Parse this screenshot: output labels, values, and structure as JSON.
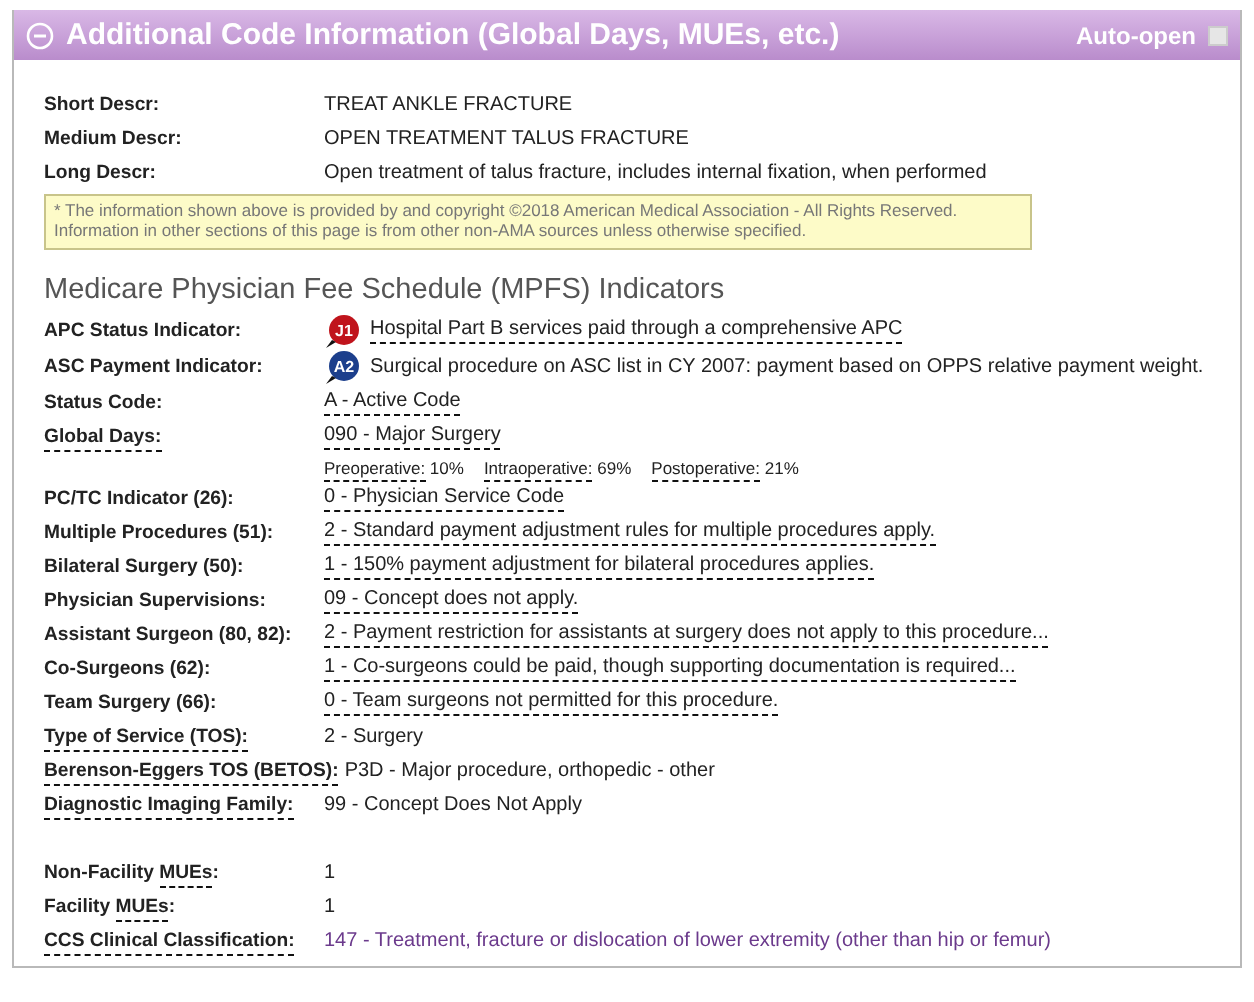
{
  "panel": {
    "title": "Additional Code Information (Global Days, MUEs, etc.)",
    "expanded": true,
    "auto_open": {
      "label": "Auto-open",
      "checked": false
    }
  },
  "descriptions": [
    {
      "label": "Short Descr:",
      "value": "TREAT ANKLE FRACTURE"
    },
    {
      "label": "Medium Descr:",
      "value": "OPEN TREATMENT TALUS FRACTURE"
    },
    {
      "label": "Long Descr:",
      "value": "Open treatment of talus fracture, includes internal fixation, when performed"
    }
  ],
  "notice": [
    "* The information shown above is provided by and copyright ©2018 American Medical Association - All Rights Reserved.",
    "Information in other sections of this page is from other non-AMA sources unless otherwise specified."
  ],
  "section_title": "Medicare Physician Fee Schedule (MPFS) Indicators",
  "indicators": [
    {
      "label": [
        {
          "text": "APC Status Indicator:",
          "dotted": false
        }
      ],
      "badge": {
        "text": "J1",
        "color": "#c0141c"
      },
      "value": "Hospital Part B services paid through a comprehensive APC",
      "dotted": true
    },
    {
      "label": [
        {
          "text": "ASC Payment Indicator:",
          "dotted": false
        }
      ],
      "badge": {
        "text": "A2",
        "color": "#1c3f8c"
      },
      "value": "Surgical procedure on ASC list in CY 2007: payment based on OPPS relative payment weight.",
      "dotted": false
    },
    {
      "label": [
        {
          "text": "Status Code:",
          "dotted": false
        }
      ],
      "value": "A - Active Code",
      "dotted": true
    },
    {
      "label": [
        {
          "text": "Global Days:",
          "dotted": true
        }
      ],
      "value": "090 - Major Surgery",
      "dotted": true,
      "breakdown": [
        {
          "label": "Preoperative:",
          "value": "10%"
        },
        {
          "label": "Intraoperative:",
          "value": "69%"
        },
        {
          "label": "Postoperative:",
          "value": "21%"
        }
      ]
    },
    {
      "label": [
        {
          "text": "PC/TC Indicator (26):",
          "dotted": false
        }
      ],
      "value": "0 - Physician Service Code",
      "dotted": true
    },
    {
      "label": [
        {
          "text": "Multiple Procedures (51):",
          "dotted": false
        }
      ],
      "value": "2 - Standard payment adjustment rules for multiple procedures apply.",
      "dotted": true
    },
    {
      "label": [
        {
          "text": "Bilateral Surgery (50):",
          "dotted": false
        }
      ],
      "value": "1 - 150% payment adjustment for bilateral procedures applies.",
      "dotted": true
    },
    {
      "label": [
        {
          "text": "Physician Supervisions:",
          "dotted": false
        }
      ],
      "value": "09 - Concept does not apply.",
      "dotted": true
    },
    {
      "label": [
        {
          "text": "Assistant Surgeon (80, 82):",
          "dotted": false
        }
      ],
      "value": "2 - Payment restriction for assistants at surgery does not apply to this procedure...",
      "dotted": true
    },
    {
      "label": [
        {
          "text": "Co-Surgeons (62):",
          "dotted": false
        }
      ],
      "value": "1 - Co-surgeons could be paid, though supporting documentation is required...",
      "dotted": true
    },
    {
      "label": [
        {
          "text": "Team Surgery (66):",
          "dotted": false
        }
      ],
      "value": "0 - Team surgeons not permitted for this procedure.",
      "dotted": true
    },
    {
      "label": [
        {
          "text": "Type of Service (TOS):",
          "dotted": true
        }
      ],
      "value": "2 - Surgery",
      "dotted": false
    },
    {
      "label": [
        {
          "text": "Berenson-Eggers TOS (BETOS):",
          "dotted": true
        }
      ],
      "value": "P3D - Major procedure, orthopedic - other",
      "dotted": false
    },
    {
      "label": [
        {
          "text": "Diagnostic Imaging Family:",
          "dotted": true
        }
      ],
      "value": "99 - Concept Does Not Apply",
      "dotted": false
    }
  ],
  "mues": [
    {
      "label": [
        {
          "text": "Non-Facility ",
          "dotted": false
        },
        {
          "text": "MUEs",
          "dotted": true
        },
        {
          "text": ":",
          "dotted": false
        }
      ],
      "value": "1",
      "dotted": false
    },
    {
      "label": [
        {
          "text": "Facility ",
          "dotted": false
        },
        {
          "text": "MUEs",
          "dotted": true
        },
        {
          "text": ":",
          "dotted": false
        }
      ],
      "value": "1",
      "dotted": false
    },
    {
      "label": [
        {
          "text": "CCS Clinical Classification:",
          "dotted": true
        }
      ],
      "value": "147 - Treatment, fracture or dislocation of lower extremity (other than hip or femur)",
      "dotted": false,
      "color": "#6b3a8c"
    }
  ]
}
